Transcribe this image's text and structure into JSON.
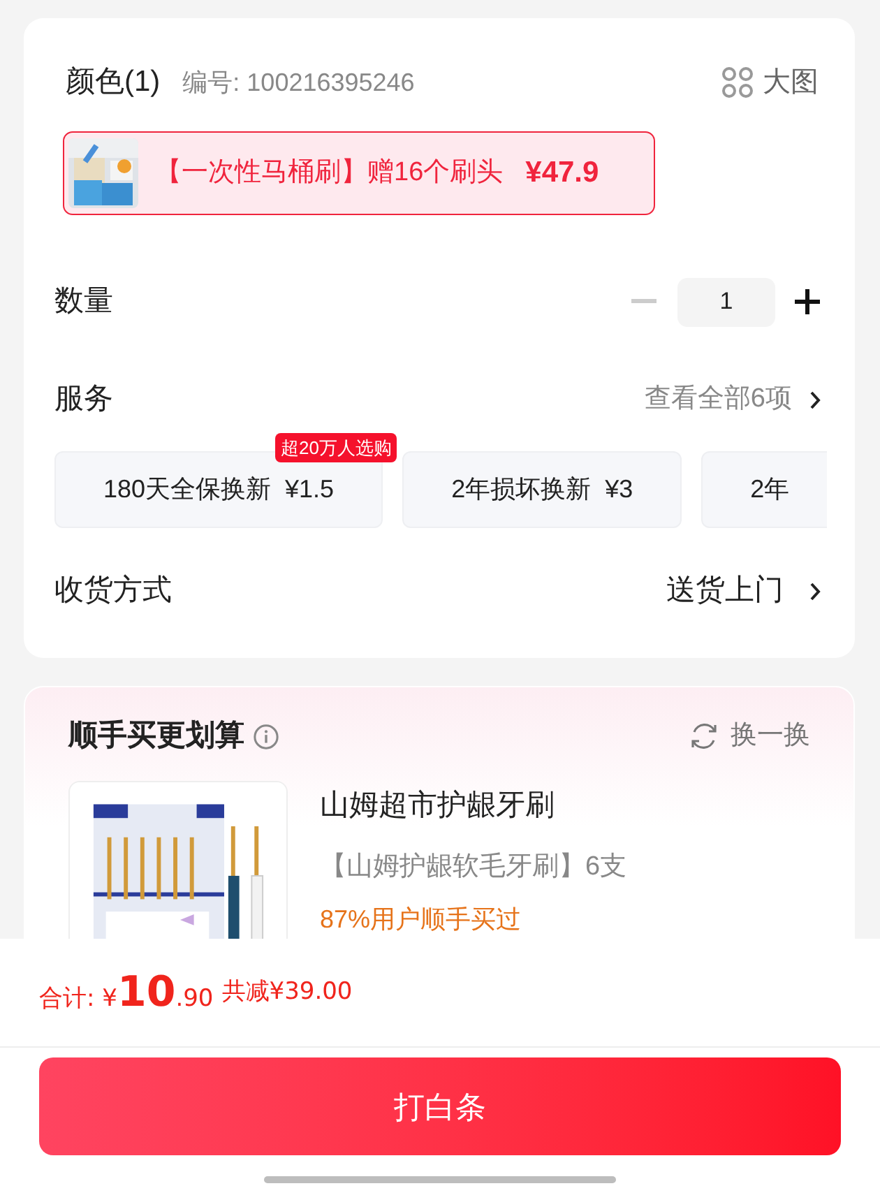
{
  "spec": {
    "label": "颜色(1)",
    "code": "编号: 100216395246",
    "view_large": "大图",
    "variants": [
      {
        "text": "【一次性马桶刷】赠16个刷头",
        "price": "¥47.9",
        "selected": true
      }
    ]
  },
  "quantity": {
    "label": "数量",
    "value": "1",
    "minus_disabled": true
  },
  "service": {
    "label": "服务",
    "link": "查看全部6项",
    "options": [
      {
        "text": "180天全保换新  ¥1.5",
        "badge": "超20万人选购",
        "selected": false
      },
      {
        "text": "2年损坏换新  ¥3",
        "selected": false
      },
      {
        "text": "2年",
        "selected": false
      }
    ]
  },
  "delivery": {
    "label": "收货方式",
    "value": "送货上门"
  },
  "addon": {
    "title": "顺手买更划算",
    "refresh": "换一换",
    "product": {
      "name": "山姆超市护龈牙刷",
      "desc": "【山姆护龈软毛牙刷】6支",
      "note": "87%用户顺手买过"
    }
  },
  "footer": {
    "total_label": "合计: ¥",
    "total_int": "10",
    "total_dec": ".90",
    "discount": "共减¥39.00",
    "button": "打白条"
  }
}
